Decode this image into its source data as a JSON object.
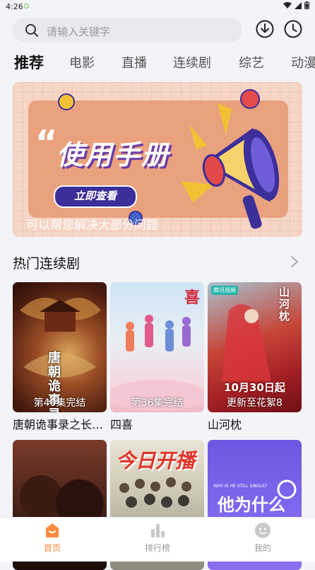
{
  "status_bar": {
    "time": "4:26"
  },
  "search": {
    "placeholder": "请输入关键字"
  },
  "tabs": [
    {
      "label": "推荐",
      "active": true
    },
    {
      "label": "电影"
    },
    {
      "label": "直播"
    },
    {
      "label": "连续剧"
    },
    {
      "label": "综艺"
    },
    {
      "label": "动漫"
    }
  ],
  "banner": {
    "title": "使用手册",
    "button": "立即查看",
    "subtitle": "可以帮您解决大部分问题"
  },
  "section": {
    "title": "热门连续剧"
  },
  "posters": [
    {
      "title": "唐朝诡事录之长…",
      "episode": "第40集完结",
      "art_text": "唐朝诡事录"
    },
    {
      "title": "四喜",
      "episode": "第36集完结",
      "art_text": "喜"
    },
    {
      "title": "山河枕",
      "episode": "更新至花絮8",
      "art_text": "10月30日起",
      "badge": "腾讯视频",
      "corner_text": "山河枕"
    },
    {
      "title": "",
      "episode": ""
    },
    {
      "title": "",
      "episode": "",
      "art_text": "今日开播"
    },
    {
      "title": "",
      "episode": "",
      "art_text": "他为什么",
      "art_small": "WHY IS HE STILL SINGLE?"
    }
  ],
  "bottom_nav": [
    {
      "label": "首页",
      "icon": "home-icon",
      "active": true
    },
    {
      "label": "排行榜",
      "icon": "ranking-icon"
    },
    {
      "label": "我的",
      "icon": "profile-icon"
    }
  ],
  "colors": {
    "accent": "#ff8a3d",
    "banner_navy": "#3d2f9a"
  }
}
